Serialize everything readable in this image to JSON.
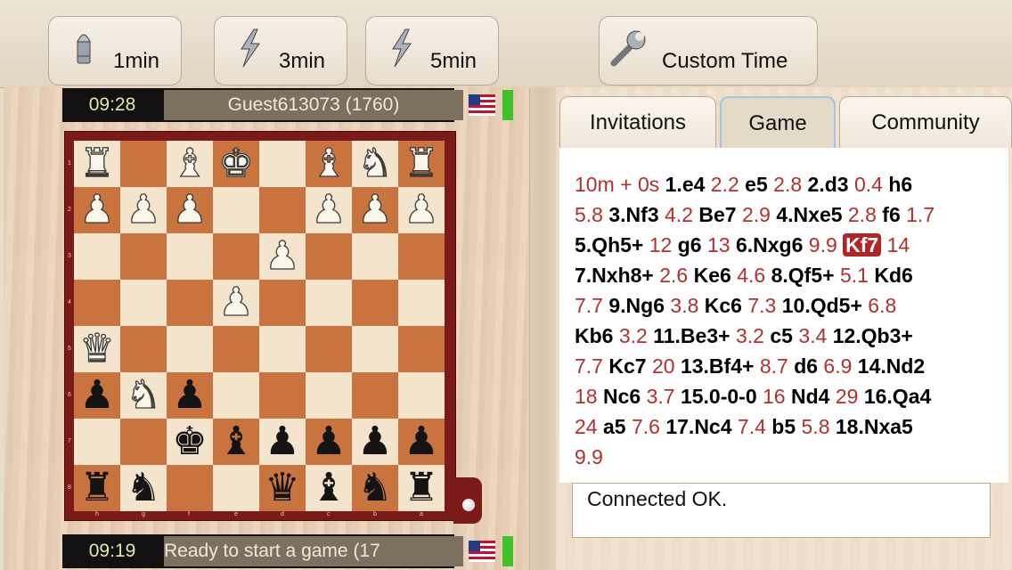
{
  "time_controls": [
    {
      "label": "1min",
      "icon": "bullet-icon"
    },
    {
      "label": "3min",
      "icon": "lightning-icon"
    },
    {
      "label": "5min",
      "icon": "lightning-icon"
    },
    {
      "label": "Custom Time",
      "icon": "wrench-icon"
    }
  ],
  "opponent": {
    "clock": "09:28",
    "name": "Guest613073 (1760)",
    "flag": "us-flag-icon"
  },
  "player": {
    "clock": "09:19",
    "status": "Ready to start a game (17",
    "flag": "us-flag-icon"
  },
  "board": {
    "rank_labels": [
      "1",
      "2",
      "3",
      "4",
      "5",
      "6",
      "7",
      "8"
    ],
    "file_labels": [
      "h",
      "g",
      "f",
      "e",
      "d",
      "c",
      "b",
      "a"
    ],
    "rows": [
      [
        "wR",
        "",
        "wB",
        "wK",
        "",
        "wB",
        "wN",
        "wR"
      ],
      [
        "wP",
        "wP",
        "wP",
        "",
        "",
        "wP",
        "wP",
        "wP"
      ],
      [
        "",
        "",
        "",
        "",
        "wP",
        "",
        "",
        ""
      ],
      [
        "",
        "",
        "",
        "wP",
        "",
        "",
        "",
        ""
      ],
      [
        "wQ",
        "",
        "",
        "",
        "",
        "",
        "",
        ""
      ],
      [
        "bP",
        "wN",
        "bP",
        "",
        "",
        "",
        "",
        ""
      ],
      [
        "",
        "",
        "bK",
        "bB",
        "bP",
        "bP",
        "bP",
        "bP"
      ],
      [
        "bR",
        "bN",
        "",
        "",
        "bQ",
        "bB",
        "bN",
        "bR"
      ]
    ]
  },
  "tabs": [
    {
      "label": "Invitations",
      "active": false
    },
    {
      "label": "Game",
      "active": true
    },
    {
      "label": "Community",
      "active": false
    }
  ],
  "moves": [
    {
      "t": "10m + 0s",
      "k": "tm"
    },
    {
      "t": "1.e4",
      "k": "mv"
    },
    {
      "t": "2.2",
      "k": "tm"
    },
    {
      "t": "e5",
      "k": "mv"
    },
    {
      "t": "2.8",
      "k": "tm"
    },
    {
      "t": "2.d3",
      "k": "mv"
    },
    {
      "t": "0.4",
      "k": "tm"
    },
    {
      "t": "h6",
      "k": "mv"
    },
    {
      "t": "5.8",
      "k": "tm"
    },
    {
      "t": "3.Nf3",
      "k": "mv"
    },
    {
      "t": "4.2",
      "k": "tm"
    },
    {
      "t": "Be7",
      "k": "mv"
    },
    {
      "t": "2.9",
      "k": "tm"
    },
    {
      "t": "4.Nxe5",
      "k": "mv"
    },
    {
      "t": "2.8",
      "k": "tm"
    },
    {
      "t": "f6",
      "k": "mv"
    },
    {
      "t": "1.7",
      "k": "tm"
    },
    {
      "t": "5.Qh5+",
      "k": "mv"
    },
    {
      "t": "12",
      "k": "tm"
    },
    {
      "t": "g6",
      "k": "mv"
    },
    {
      "t": "13",
      "k": "tm"
    },
    {
      "t": "6.Nxg6",
      "k": "mv"
    },
    {
      "t": "9.9",
      "k": "tm"
    },
    {
      "t": "Kf7",
      "k": "hl"
    },
    {
      "t": "14",
      "k": "tm"
    },
    {
      "t": "7.Nxh8+",
      "k": "mv"
    },
    {
      "t": "2.6",
      "k": "tm"
    },
    {
      "t": "Ke6",
      "k": "mv"
    },
    {
      "t": "4.6",
      "k": "tm"
    },
    {
      "t": "8.Qf5+",
      "k": "mv"
    },
    {
      "t": "5.1",
      "k": "tm"
    },
    {
      "t": "Kd6",
      "k": "mv"
    },
    {
      "t": "7.7",
      "k": "tm"
    },
    {
      "t": "9.Ng6",
      "k": "mv"
    },
    {
      "t": "3.8",
      "k": "tm"
    },
    {
      "t": "Kc6",
      "k": "mv"
    },
    {
      "t": "7.3",
      "k": "tm"
    },
    {
      "t": "10.Qd5+",
      "k": "mv"
    },
    {
      "t": "6.8",
      "k": "tm"
    },
    {
      "t": "Kb6",
      "k": "mv"
    },
    {
      "t": "3.2",
      "k": "tm"
    },
    {
      "t": "11.Be3+",
      "k": "mv"
    },
    {
      "t": "3.2",
      "k": "tm"
    },
    {
      "t": "c5",
      "k": "mv"
    },
    {
      "t": "3.4",
      "k": "tm"
    },
    {
      "t": "12.Qb3+",
      "k": "mv"
    },
    {
      "t": "7.7",
      "k": "tm"
    },
    {
      "t": "Kc7",
      "k": "mv"
    },
    {
      "t": "20",
      "k": "tm"
    },
    {
      "t": "13.Bf4+",
      "k": "mv"
    },
    {
      "t": "8.7",
      "k": "tm"
    },
    {
      "t": "d6",
      "k": "mv"
    },
    {
      "t": "6.9",
      "k": "tm"
    },
    {
      "t": "14.Nd2",
      "k": "mv"
    },
    {
      "t": "18",
      "k": "tm"
    },
    {
      "t": "Nc6",
      "k": "mv"
    },
    {
      "t": "3.7",
      "k": "tm"
    },
    {
      "t": "15.0-0-0",
      "k": "mv"
    },
    {
      "t": "16",
      "k": "tm"
    },
    {
      "t": "Nd4",
      "k": "mv"
    },
    {
      "t": "29",
      "k": "tm"
    },
    {
      "t": "16.Qa4",
      "k": "mv"
    },
    {
      "t": "24",
      "k": "tm"
    },
    {
      "t": "a5",
      "k": "mv"
    },
    {
      "t": "7.6",
      "k": "tm"
    },
    {
      "t": "17.Nc4",
      "k": "mv"
    },
    {
      "t": "7.4",
      "k": "tm"
    },
    {
      "t": "b5",
      "k": "mv"
    },
    {
      "t": "5.8",
      "k": "tm"
    },
    {
      "t": "18.Nxa5",
      "k": "mv"
    },
    {
      "t": "9.9",
      "k": "tm"
    }
  ],
  "status_message": "Connected OK.",
  "colors": {
    "accent_red": "#b02525",
    "time_red": "#b03030",
    "clock_text": "#e3e8a8",
    "indicator": "#3ec12b"
  }
}
